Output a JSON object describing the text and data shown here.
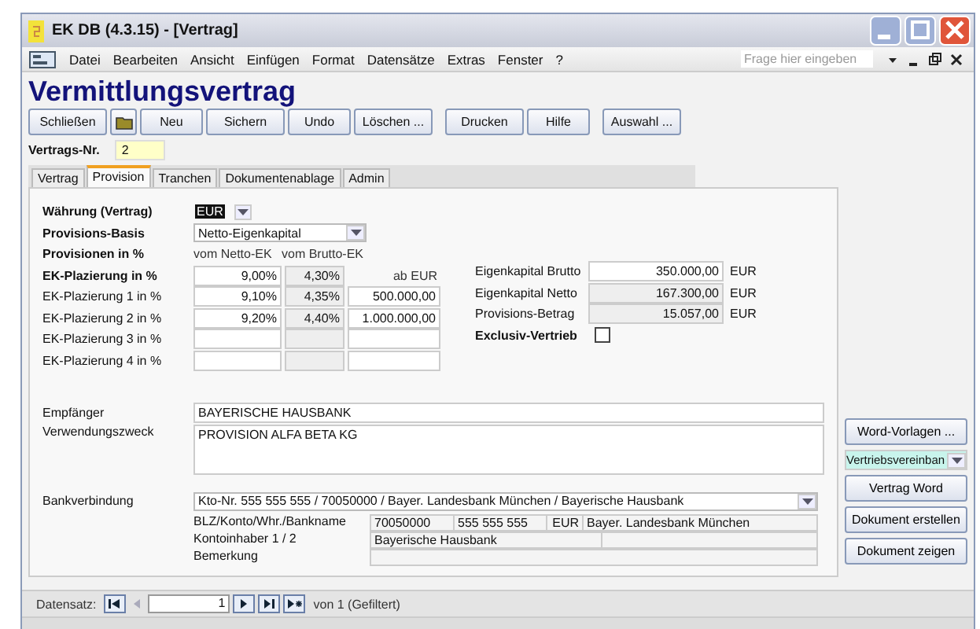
{
  "window": {
    "title": "EK DB (4.3.15) - [Vertrag]"
  },
  "menu": [
    "Datei",
    "Bearbeiten",
    "Ansicht",
    "Einfügen",
    "Format",
    "Datensätze",
    "Extras",
    "Fenster",
    "?"
  ],
  "help_search": {
    "placeholder": "Frage hier eingeben"
  },
  "form_title": "Vermittlungsvertrag",
  "toolbar": [
    {
      "kind": "text",
      "label": "Schließen"
    },
    {
      "kind": "icon"
    },
    {
      "kind": "text",
      "label": "Neu"
    },
    {
      "kind": "text",
      "label": "Sichern"
    },
    {
      "kind": "text",
      "label": "Undo"
    },
    {
      "kind": "text",
      "label": "Löschen ..."
    },
    {
      "kind": "gap"
    },
    {
      "kind": "text",
      "label": "Drucken"
    },
    {
      "kind": "text",
      "label": "Hilfe"
    },
    {
      "kind": "gap"
    },
    {
      "kind": "text",
      "label": "Auswahl ..."
    }
  ],
  "contract_no": {
    "label": "Vertrags-Nr.",
    "value": "2"
  },
  "tabs": [
    {
      "label": "Vertrag",
      "selected": false
    },
    {
      "label": "Provision",
      "selected": true
    },
    {
      "label": "Tranchen",
      "selected": false
    },
    {
      "label": "Dokumentenablage",
      "selected": false
    },
    {
      "label": "Admin",
      "selected": false
    }
  ],
  "currency": {
    "label": "Währung (Vertrag)",
    "value": "EUR"
  },
  "basis": {
    "label": "Provisions-Basis",
    "value": "Netto-Eigenkapital"
  },
  "provisions": {
    "label": "Provisionen in %",
    "col_netto": "vom Netto-EK",
    "col_brutto": "vom Brutto-EK",
    "rows": [
      {
        "kind": "header",
        "label": "EK-Plazierung in %",
        "netto": "9,00%",
        "brutto": "4,30%",
        "from": "ab EUR"
      },
      {
        "kind": "field",
        "label": "EK-Plazierung 1 in %",
        "netto": "9,10%",
        "brutto": "4,35%",
        "from": "500.000,00"
      },
      {
        "kind": "field",
        "label": "EK-Plazierung 2 in %",
        "netto": "9,20%",
        "brutto": "4,40%",
        "from": "1.000.000,00"
      },
      {
        "kind": "field",
        "label": "EK-Plazierung 3 in %"
      },
      {
        "kind": "field",
        "label": "EK-Plazierung 4 in %"
      }
    ]
  },
  "totals": [
    {
      "label": "Eigenkapital Brutto",
      "value": "350.000,00",
      "unit": "EUR",
      "locked": false
    },
    {
      "label": "Eigenkapital Netto",
      "value": "167.300,00",
      "unit": "EUR",
      "locked": true
    },
    {
      "label": "Provisions-Betrag",
      "value": "15.057,00",
      "unit": "EUR",
      "locked": true
    }
  ],
  "exclusive": {
    "label": "Exclusiv-Vertrieb",
    "checked": false
  },
  "recipient": {
    "label": "Empfänger",
    "value": "BAYERISCHE HAUSBANK"
  },
  "purpose": {
    "label": "Verwendungszweck",
    "value": "PROVISION ALFA BETA KG"
  },
  "bank": {
    "label": "Bankverbindung",
    "value": "Kto-Nr. 555 555 555 / 70050000 / Bayer. Landesbank München / Bayerische Hausbank",
    "details": [
      {
        "label": "BLZ/Konto/Whr./Bankname",
        "cells": [
          "70050000",
          "555 555 555",
          "EUR",
          "Bayer. Landesbank München"
        ]
      },
      {
        "label": "Kontoinhaber 1 / 2",
        "cells": [
          "Bayerische Hausbank"
        ]
      },
      {
        "label": "Bemerkung"
      }
    ]
  },
  "side": [
    {
      "kind": "button",
      "label": "Word-Vorlagen ..."
    },
    {
      "kind": "combo",
      "label": "Vertriebsvereinban"
    },
    {
      "kind": "button",
      "label": "Vertrag Word"
    },
    {
      "kind": "button",
      "label": "Dokument erstellen"
    },
    {
      "kind": "button",
      "label": "Dokument zeigen"
    }
  ],
  "navigation": {
    "label": "Datensatz:",
    "current": "1",
    "total": "von 1 (Gefiltert)"
  }
}
